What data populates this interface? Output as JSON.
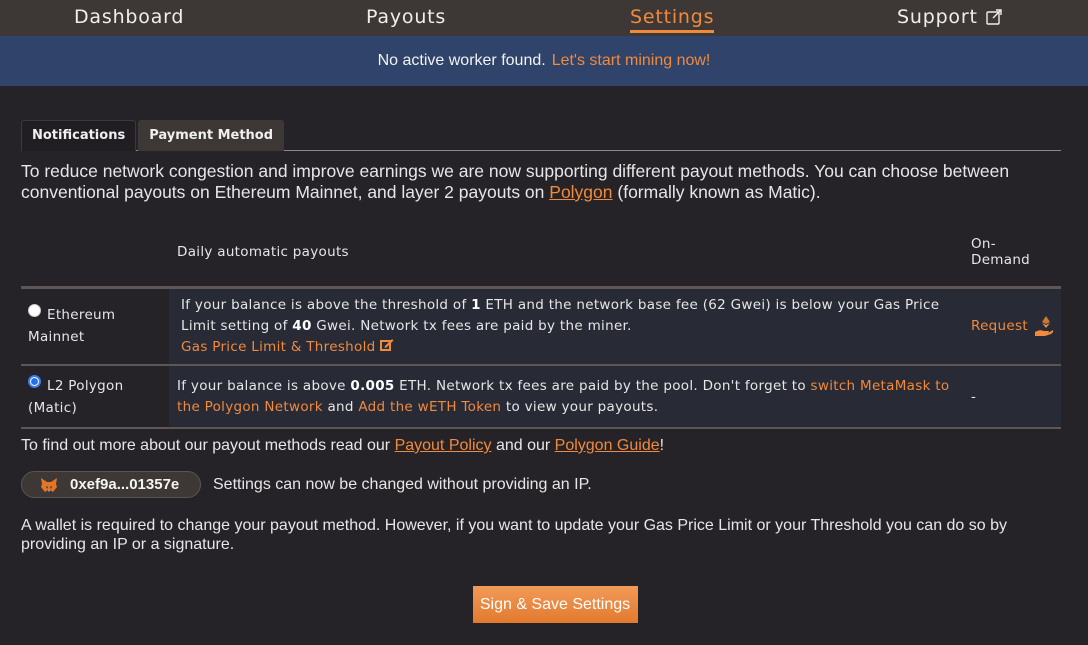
{
  "nav": {
    "items": [
      {
        "label": "Dashboard",
        "active": false
      },
      {
        "label": "Payouts",
        "active": false
      },
      {
        "label": "Settings",
        "active": true
      },
      {
        "label": "Support",
        "active": false,
        "icon": "external-link-icon"
      }
    ]
  },
  "banner": {
    "text": "No active worker found.",
    "link": "Let's start mining now!"
  },
  "tabs": [
    {
      "label": "Notifications",
      "active": false
    },
    {
      "label": "Payment Method",
      "active": true
    }
  ],
  "intro": {
    "text_before": "To reduce network congestion and improve earnings we are now supporting different payout methods. You can choose between conventional payouts on Ethereum Mainnet, and layer 2 payouts on ",
    "link": "Polygon",
    "text_after": " (formally known as Matic)."
  },
  "table": {
    "headers": {
      "daily": "Daily automatic payouts",
      "ondemand": "On-Demand"
    },
    "rows": [
      {
        "method": "Ethereum Mainnet",
        "selected": false,
        "desc": {
          "p1": "If your balance is above the threshold of ",
          "threshold": "1",
          "p2": " ETH and the network base fee (62 Gwei) is below your Gas Price Limit setting of ",
          "gas_limit": "40",
          "p3": " Gwei. Network tx fees are paid by the miner.",
          "link": "Gas Price Limit & Threshold"
        },
        "ondemand": "Request"
      },
      {
        "method": "L2 Polygon (Matic)",
        "selected": true,
        "desc": {
          "p1": "If your balance is above ",
          "threshold": "0.005",
          "p2": " ETH. Network tx fees are paid by the pool. Don't forget to ",
          "link1": "switch MetaMask to the Polygon Network",
          "p3": " and ",
          "link2": "Add the wETH Token",
          "p4": " to view your payouts."
        },
        "ondemand": "-"
      }
    ]
  },
  "more_info": {
    "text1": "To find out more about our payout methods read our ",
    "link1": "Payout Policy",
    "text2": " and our ",
    "link2": "Polygon Guide",
    "text3": "!"
  },
  "wallet": {
    "address": "0xef9a...01357e",
    "note": "Settings can now be changed without providing an IP."
  },
  "wallet_info": "A wallet is required to change your payout method. However, if you want to update your Gas Price Limit or your Threshold you can do so by providing an IP or a signature.",
  "save_button": "Sign & Save Settings",
  "colors": {
    "accent": "#f08a3c",
    "banner": "#30436a",
    "nav": "#3d3835",
    "background": "#252327"
  }
}
